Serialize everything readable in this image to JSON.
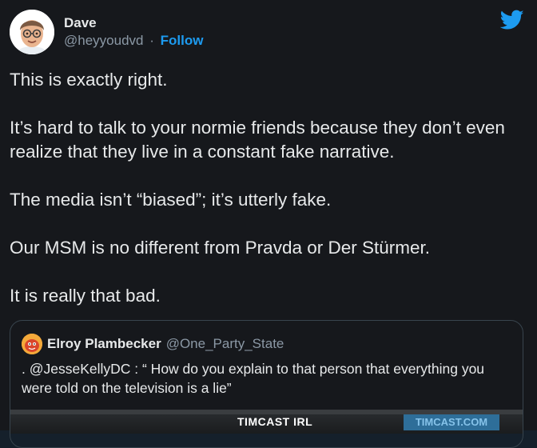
{
  "author": {
    "display_name": "Dave",
    "handle": "@heyyoudvd",
    "separator": "·",
    "follow_label": "Follow"
  },
  "tweet": {
    "paragraphs": [
      "This is exactly right.",
      "It’s hard to talk to your normie friends because they don’t even realize that they live in a constant fake narrative.",
      "The media isn’t “biased”; it’s utterly fake.",
      "Our MSM is no different from Pravda or Der Stürmer.",
      "It is really that bad."
    ]
  },
  "quoted_tweet": {
    "display_name": "Elroy Plambecker",
    "handle": "@One_Party_State",
    "text": ". @JesseKellyDC : “ How do you explain to that person that everything you were told on the television is a lie”",
    "media_caption": "TIMCAST IRL",
    "media_brand": "TIMCAST.COM"
  },
  "icons": {
    "brand": "twitter-bird-icon",
    "avatar": "memoji-avatar",
    "quote_avatar": "quoted-user-avatar"
  },
  "colors": {
    "background": "#16181c",
    "text": "#e7e9ea",
    "secondary": "#8b98a5",
    "accent": "#1d9bf0"
  }
}
